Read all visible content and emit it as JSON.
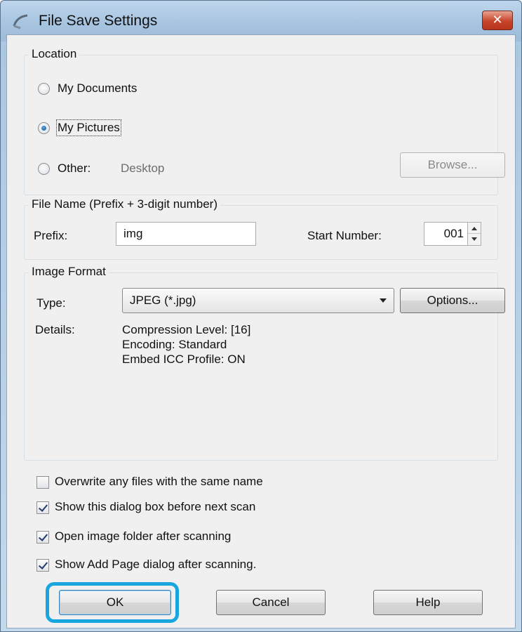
{
  "window": {
    "title": "File Save Settings",
    "close_symbol": "✕"
  },
  "location": {
    "legend": "Location",
    "options": [
      {
        "label": "My Documents",
        "checked": false
      },
      {
        "label": "My Pictures",
        "checked": true
      },
      {
        "label": "Other:",
        "checked": false
      }
    ],
    "other_value": "Desktop",
    "browse_label": "Browse..."
  },
  "file_name": {
    "legend": "File Name (Prefix + 3-digit number)",
    "prefix_label": "Prefix:",
    "prefix_value": "img",
    "start_number_label": "Start Number:",
    "start_number_value": "001"
  },
  "image_format": {
    "legend": "Image Format",
    "type_label": "Type:",
    "type_value": "JPEG (*.jpg)",
    "options_label": "Options...",
    "details_label": "Details:",
    "details_lines": [
      "Compression Level: [16]",
      "Encoding: Standard",
      "Embed ICC Profile: ON"
    ]
  },
  "checkboxes": [
    {
      "label": "Overwrite any files with the same name",
      "checked": false
    },
    {
      "label": "Show this dialog box before next scan",
      "checked": true
    },
    {
      "label": "Open image folder after scanning",
      "checked": true
    },
    {
      "label": "Show Add Page dialog after scanning.",
      "checked": true
    }
  ],
  "buttons": {
    "ok": "OK",
    "cancel": "Cancel",
    "help": "Help"
  },
  "colors": {
    "highlight": "#19a5de",
    "close_red": "#c7432a"
  },
  "icons": {
    "title_icon": "scanner-icon",
    "close": "close-icon"
  }
}
